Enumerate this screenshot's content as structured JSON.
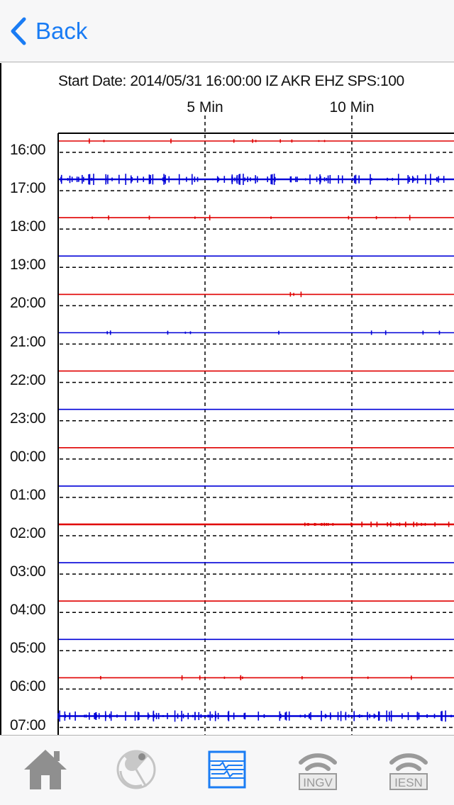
{
  "nav": {
    "back_label": "Back"
  },
  "chart_header": {
    "start_info": "Start Date: 2014/05/31 16:00:00 IZ AKR EHZ SPS:100",
    "marker_5": "5 Min",
    "marker_10": "10 Min"
  },
  "tabbar": {
    "ingv_label": "INGV",
    "iesn_label": "IESN"
  },
  "colors": {
    "accent": "#1a7cf4",
    "trace_red": "#e00000",
    "trace_blue": "#0000d8",
    "grid": "#000000",
    "icon_gray": "#9a9a9a"
  },
  "chart_data": {
    "type": "line",
    "title": "Start Date: 2014/05/31 16:00:00 IZ AKR EHZ SPS:100",
    "x_unit": "minutes",
    "xlim": [
      0,
      15
    ],
    "x_markers": [
      {
        "minute": 5,
        "label": "5 Min"
      },
      {
        "minute": 10,
        "label": "10 Min"
      }
    ],
    "rows": [
      {
        "time": "16:00",
        "color": "red",
        "activity": "low"
      },
      {
        "time": "17:00",
        "color": "blue",
        "activity": "high"
      },
      {
        "time": "18:00",
        "color": "red",
        "activity": "low"
      },
      {
        "time": "19:00",
        "color": "blue",
        "activity": "none"
      },
      {
        "time": "20:00",
        "color": "red",
        "activity": "minimal"
      },
      {
        "time": "21:00",
        "color": "blue",
        "activity": "low"
      },
      {
        "time": "22:00",
        "color": "red",
        "activity": "none"
      },
      {
        "time": "23:00",
        "color": "blue",
        "activity": "none"
      },
      {
        "time": "00:00",
        "color": "red",
        "activity": "none"
      },
      {
        "time": "01:00",
        "color": "blue",
        "activity": "none"
      },
      {
        "time": "02:00",
        "color": "red",
        "activity": "medium"
      },
      {
        "time": "03:00",
        "color": "blue",
        "activity": "none"
      },
      {
        "time": "04:00",
        "color": "red",
        "activity": "none"
      },
      {
        "time": "05:00",
        "color": "blue",
        "activity": "none"
      },
      {
        "time": "06:00",
        "color": "red",
        "activity": "low"
      },
      {
        "time": "07:00",
        "color": "blue",
        "activity": "high"
      }
    ]
  }
}
